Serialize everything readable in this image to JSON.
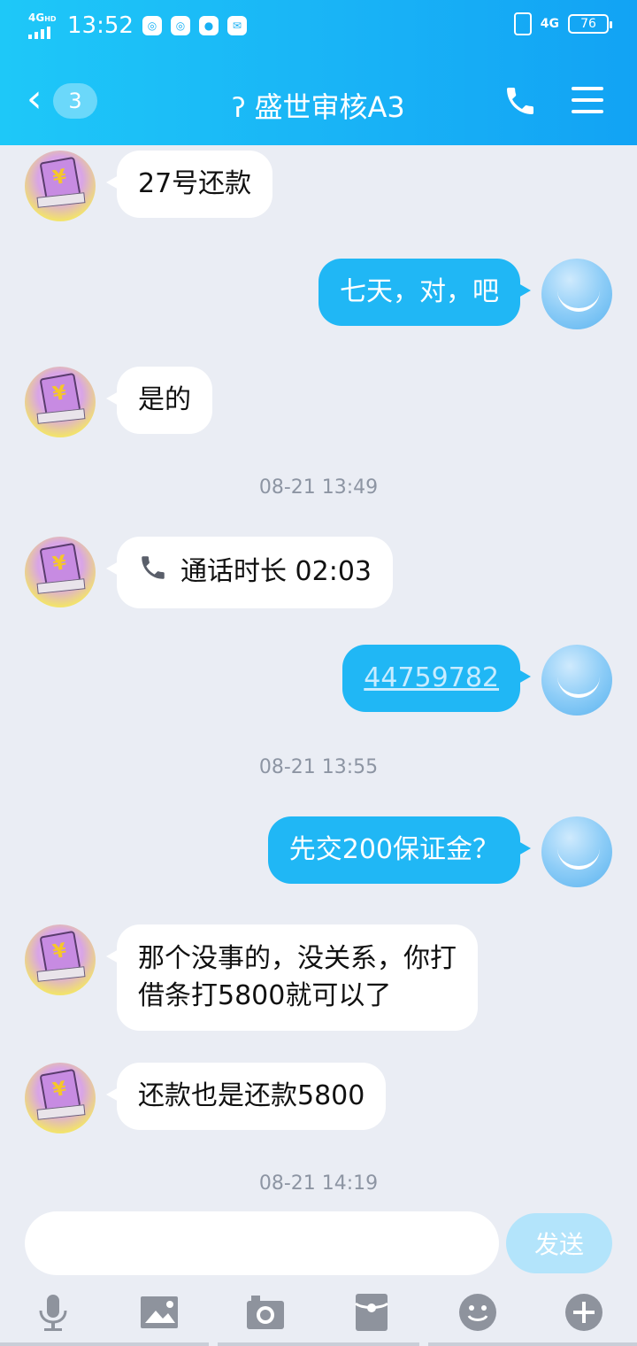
{
  "status_bar": {
    "network": "4G",
    "network_sup": "HD",
    "time": "13:52",
    "right_network": "4G",
    "battery": "76"
  },
  "header": {
    "back_count": "3",
    "title": "盛世审核A3"
  },
  "messages": [
    {
      "side": "other",
      "text": "27号还款"
    },
    {
      "side": "me",
      "text": "七天，对，吧"
    },
    {
      "side": "other",
      "text": "是的"
    },
    {
      "timestamp": "08-21 13:49"
    },
    {
      "side": "other",
      "call_label": "通话时长 02:03"
    },
    {
      "side": "me",
      "text": "44759782"
    },
    {
      "timestamp": "08-21 13:55"
    },
    {
      "side": "me",
      "text": "先交200保证金？"
    },
    {
      "side": "other",
      "text_line1": "那个没事的，没关系，你打",
      "text_line2": "借条打5800就可以了"
    },
    {
      "side": "other",
      "text": "还款也是还款5800"
    },
    {
      "timestamp": "08-21 14:19"
    }
  ],
  "input": {
    "value": "",
    "send_label": "发送"
  },
  "colors": {
    "header": "#19b3f6",
    "my_bubble": "#20b7f5",
    "background": "#eaedf4"
  }
}
